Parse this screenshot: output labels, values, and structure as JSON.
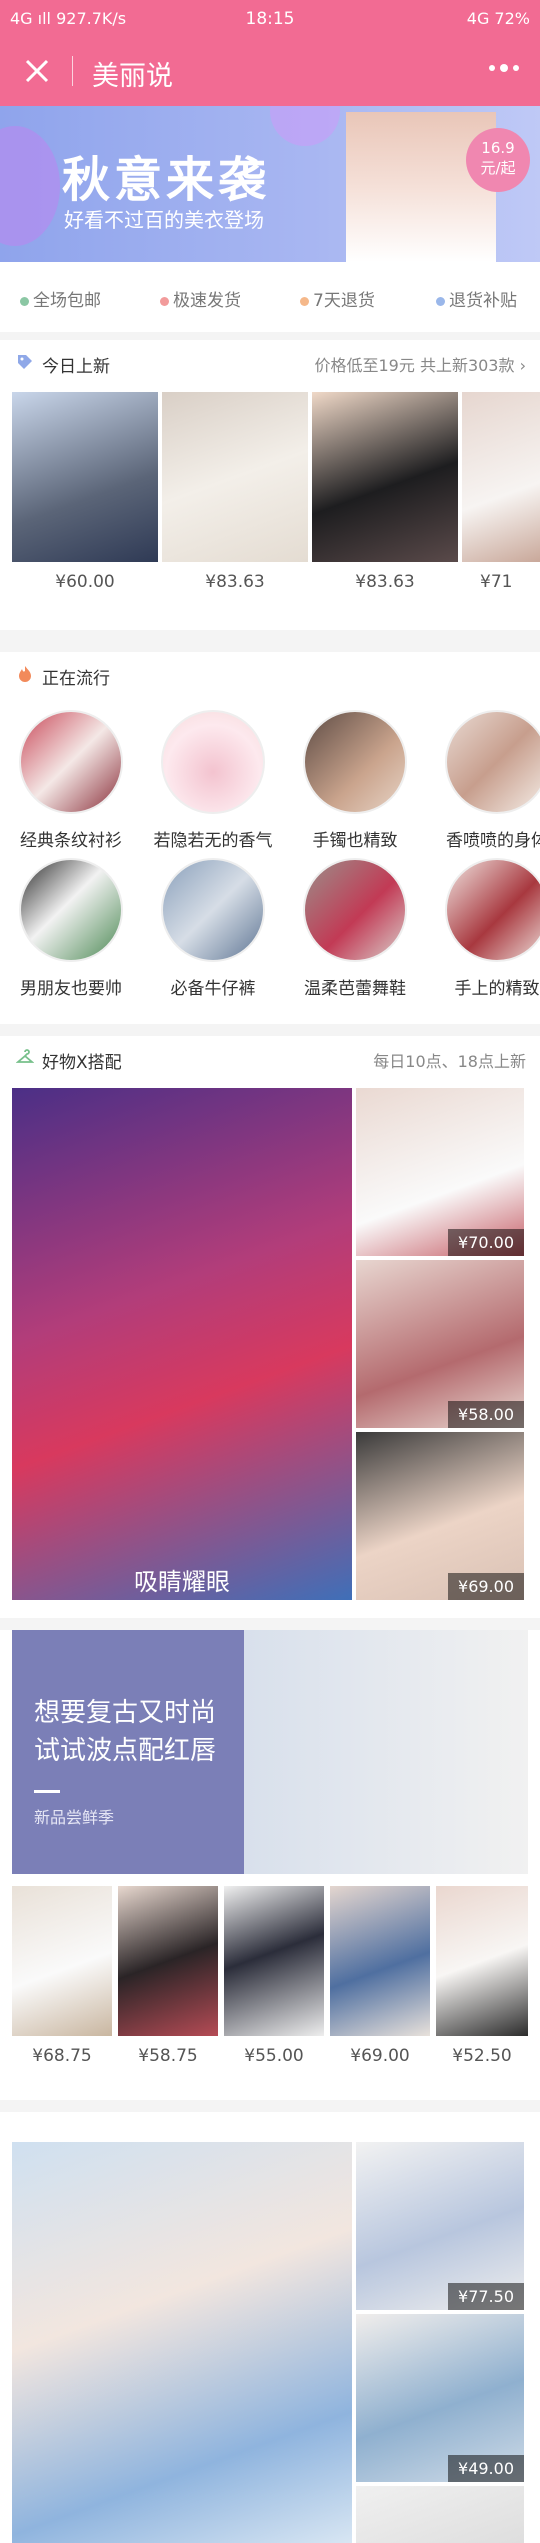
{
  "status_bar": {
    "left": "4G ıll  927.7K/s",
    "time": "18:15",
    "right": "4G 72%"
  },
  "nav": {
    "title": "美丽说"
  },
  "banner": {
    "title": "秋意来袭",
    "subtitle": "好看不过百的美衣登场",
    "price_amount": "16.9",
    "price_unit": "元/起"
  },
  "features": [
    {
      "label": "全场包邮",
      "color": "#8bc7a4"
    },
    {
      "label": "极速发货",
      "color": "#f29b9b"
    },
    {
      "label": "7天退货",
      "color": "#f5b88a"
    },
    {
      "label": "退货补贴",
      "color": "#9ab7ea"
    }
  ],
  "new_arrivals": {
    "title": "今日上新",
    "meta": "价格低至19元 共上新303款",
    "items": [
      {
        "price": "¥60.00"
      },
      {
        "price": "¥83.63"
      },
      {
        "price": "¥83.63"
      },
      {
        "price": "¥71"
      }
    ]
  },
  "trending": {
    "title": "正在流行",
    "items": [
      {
        "label": "经典条纹衬衫"
      },
      {
        "label": "若隐若无的香气"
      },
      {
        "label": "手镯也精致"
      },
      {
        "label": "香喷喷的身体"
      },
      {
        "label": "男朋友也要帅"
      },
      {
        "label": "必备牛仔裤"
      },
      {
        "label": "温柔芭蕾舞鞋"
      },
      {
        "label": "手上的精致"
      }
    ]
  },
  "matching": {
    "title": "好物X搭配",
    "meta": "每日10点、18点上新",
    "hero_caption": "吸睛耀眼",
    "side_prices": [
      "¥70.00",
      "¥58.00",
      "¥69.00"
    ]
  },
  "promo": {
    "title_line1": "想要复古又时尚",
    "title_line2": "试试波点配红唇",
    "subtitle": "新品尝鲜季"
  },
  "promo_items": [
    {
      "price": "¥68.75"
    },
    {
      "price": "¥58.75"
    },
    {
      "price": "¥55.00"
    },
    {
      "price": "¥69.00"
    },
    {
      "price": "¥52.50"
    }
  ],
  "bottom": {
    "side_prices": [
      "¥77.50",
      "¥49.00"
    ]
  }
}
